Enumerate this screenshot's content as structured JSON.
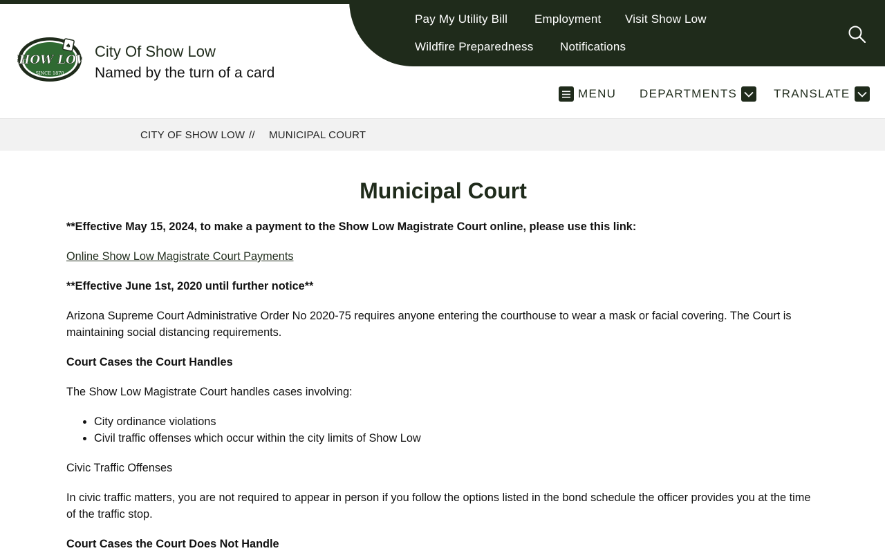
{
  "colors": {
    "brand_dark": "#1f2b1b",
    "breadcrumb_bg": "#f2f2f2"
  },
  "site": {
    "logo_text": "SHOW LOW",
    "logo_since": "SINCE 1870",
    "title": "City Of Show Low",
    "tagline": "Named by the turn of a card"
  },
  "utility_nav": [
    {
      "label": "Pay My Utility Bill"
    },
    {
      "label": "Employment"
    },
    {
      "label": "Visit Show Low"
    },
    {
      "label": "Wildfire Preparedness"
    },
    {
      "label": "Notifications"
    }
  ],
  "icons": {
    "search": "search-icon",
    "menu": "hamburger-icon",
    "dropdown": "chevron-down-icon"
  },
  "main_nav": {
    "menu": "MENU",
    "departments": "DEPARTMENTS",
    "translate": "TRANSLATE"
  },
  "breadcrumb": {
    "home": "CITY OF SHOW LOW",
    "separator": "//",
    "current": "MUNICIPAL COURT"
  },
  "content": {
    "title": "Municipal Court",
    "notice_payment": "**Effective May 15, 2024, to make a payment to the Show Low Magistrate Court online, please use this link:",
    "payment_link": "Online Show Low Magistrate Court Payments",
    "notice_effective": "**Effective June 1st, 2020 until further notice**",
    "order_text": "Arizona Supreme Court Administrative Order No 2020-75 requires anyone entering the courthouse to wear a mask or facial covering.  The Court is maintaining social distancing requirements.",
    "handles_heading": "Court Cases the Court Handles",
    "handles_intro": "The Show Low Magistrate Court handles cases involving:",
    "handles_list": [
      "City ordinance violations",
      "Civil traffic offenses which occur within the city limits of Show Low"
    ],
    "civic_heading": "Civic Traffic Offenses",
    "civic_text": "In civic traffic matters, you are not required to appear in person if you follow the options listed in the bond schedule the officer provides you at the time of the traffic stop.",
    "not_handle_heading": "Court Cases the Court Does Not Handle"
  }
}
